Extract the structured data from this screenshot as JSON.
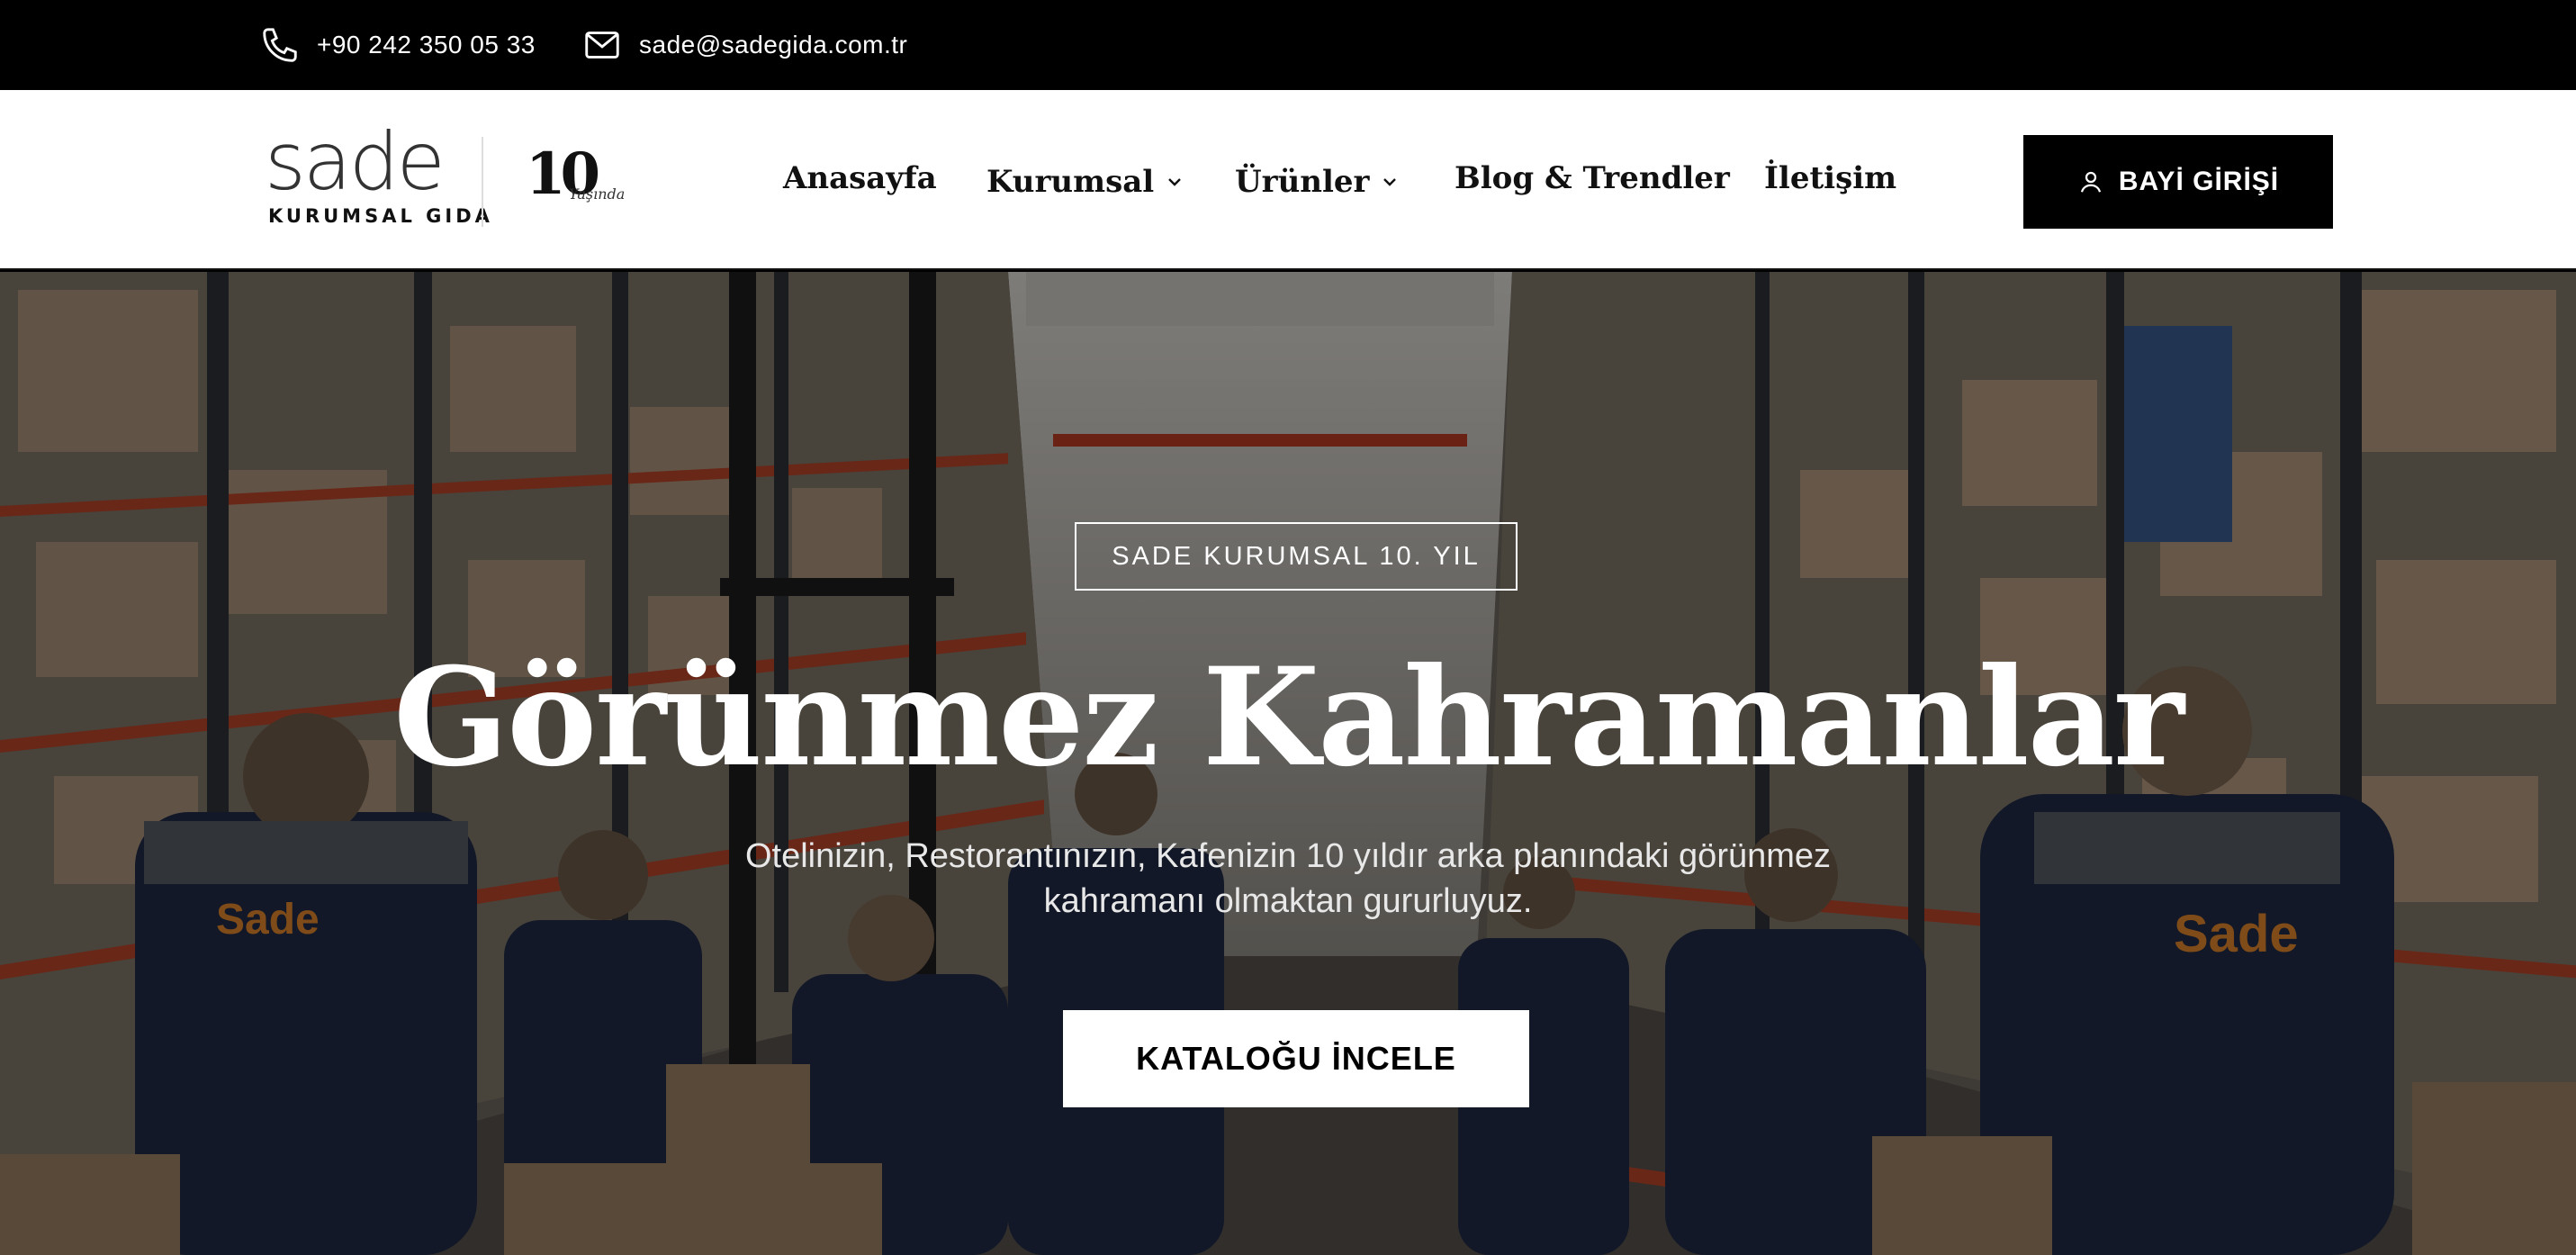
{
  "topbar": {
    "phone": "+90 242 350 05 33",
    "email": "sade@sadegida.com.tr",
    "phone_icon": "phone-icon",
    "email_icon": "mail-icon"
  },
  "header": {
    "logo": {
      "word": "sade",
      "sub": "KURUMSAL GIDA"
    },
    "anniversary": {
      "number": "10",
      "script": "Yaşında"
    },
    "nav": [
      {
        "label": "Anasayfa",
        "has_dropdown": false
      },
      {
        "label": "Kurumsal",
        "has_dropdown": true
      },
      {
        "label": "Ürünler",
        "has_dropdown": true
      },
      {
        "label": "Blog & Trendler",
        "has_dropdown": false
      },
      {
        "label": "İletişim",
        "has_dropdown": false
      }
    ],
    "dealer_button": {
      "label": "BAYİ GİRİŞİ",
      "icon": "user-icon"
    }
  },
  "hero": {
    "badge": "SADE KURUMSAL 10. YIL",
    "title": "Görünmez Kahramanlar",
    "subtitle": "Otelinizin, Restorantınızın, Kafenizin 10 yıldır arka planındaki görünmez kahramanı olmaktan gururluyuz.",
    "cta": "KATALOĞU İNCELE",
    "jacket_text": "Sade"
  },
  "colors": {
    "topbar_bg": "#000000",
    "header_bg": "#ffffff",
    "button_bg": "#000000",
    "accent_orange": "#d9822b",
    "jacket_navy": "#1f2a44"
  }
}
